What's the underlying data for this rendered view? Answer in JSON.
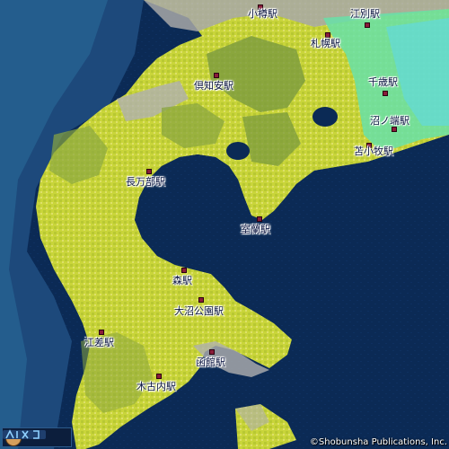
{
  "map": {
    "stations": [
      {
        "id": "otaru",
        "name": "小樽駅"
      },
      {
        "id": "ebetsu",
        "name": "江別駅"
      },
      {
        "id": "sapporo",
        "name": "札幌駅"
      },
      {
        "id": "kutchan",
        "name": "倶知安駅"
      },
      {
        "id": "chitose",
        "name": "千歳駅"
      },
      {
        "id": "numanohata",
        "name": "沼ノ端駅"
      },
      {
        "id": "tomakomai",
        "name": "苫小牧駅"
      },
      {
        "id": "oshamambe",
        "name": "長万部駅"
      },
      {
        "id": "muroran",
        "name": "室蘭駅"
      },
      {
        "id": "mori",
        "name": "森駅"
      },
      {
        "id": "onumakoen",
        "name": "大沼公園駅"
      },
      {
        "id": "esashi",
        "name": "江差駅"
      },
      {
        "id": "hakodate",
        "name": "函館駅"
      },
      {
        "id": "kikonai",
        "name": "木古内駅"
      }
    ],
    "colors": {
      "sea_deep": "#0b2a55",
      "sea_shallow": "#2a5a8a",
      "lowland": "#9fd8a8",
      "land": "#c9d53a",
      "highland": "#6e8a3a",
      "urban": "#b0b0b0",
      "station_marker": "#8a1c3a"
    },
    "copyright": "©Shobunsha Publications, Inc."
  }
}
